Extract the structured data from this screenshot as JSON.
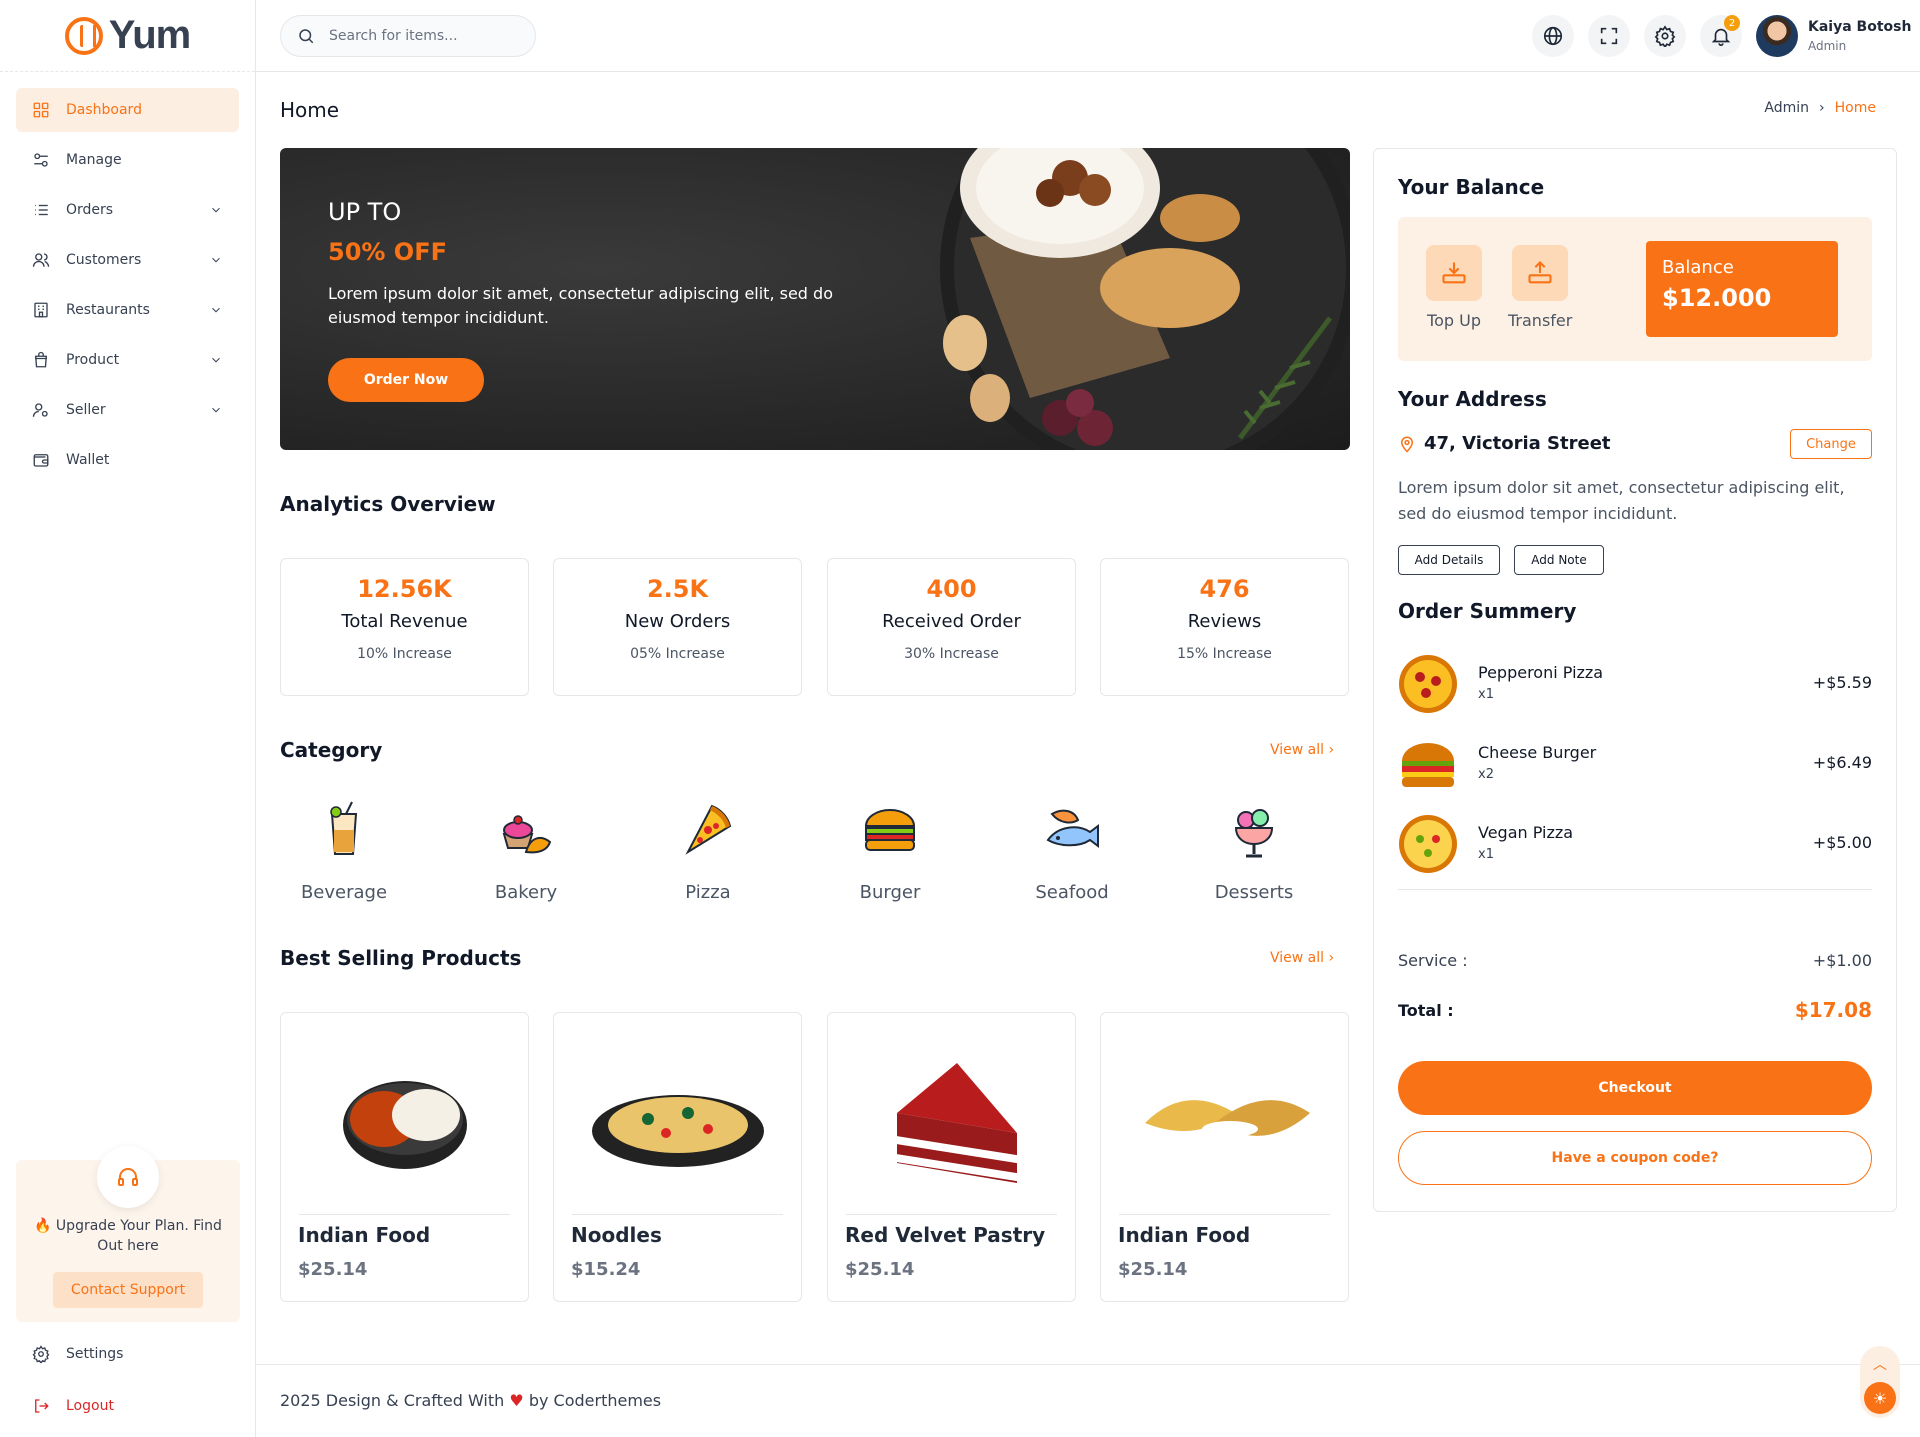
{
  "app": {
    "name": "Yum"
  },
  "sidebar": {
    "items": [
      {
        "label": "Dashboard",
        "icon": "grid-icon",
        "active": true,
        "expandable": false
      },
      {
        "label": "Manage",
        "icon": "sliders-icon",
        "active": false,
        "expandable": false
      },
      {
        "label": "Orders",
        "icon": "list-icon",
        "active": false,
        "expandable": true
      },
      {
        "label": "Customers",
        "icon": "users-icon",
        "active": false,
        "expandable": true
      },
      {
        "label": "Restaurants",
        "icon": "building-icon",
        "active": false,
        "expandable": true
      },
      {
        "label": "Product",
        "icon": "bag-icon",
        "active": false,
        "expandable": true
      },
      {
        "label": "Seller",
        "icon": "user-gear-icon",
        "active": false,
        "expandable": true
      },
      {
        "label": "Wallet",
        "icon": "wallet-icon",
        "active": false,
        "expandable": false
      }
    ],
    "upgrade": {
      "text": "🔥 Upgrade Your Plan. Find Out here",
      "button": "Contact Support"
    },
    "settings": "Settings",
    "logout": "Logout"
  },
  "topbar": {
    "search_placeholder": "Search for items...",
    "notification_count": "2",
    "user": {
      "name": "Kaiya Botosh",
      "role": "Admin"
    }
  },
  "page": {
    "title": "Home",
    "breadcrumb": [
      "Admin",
      "Home"
    ]
  },
  "hero": {
    "line1": "UP TO",
    "line2": "50% OFF",
    "description": "Lorem ipsum dolor sit amet, consectetur adipiscing elit, sed do eiusmod tempor incididunt.",
    "button": "Order Now"
  },
  "analytics": {
    "title": "Analytics Overview",
    "stats": [
      {
        "value": "12.56K",
        "label": "Total Revenue",
        "sub": "10% Increase"
      },
      {
        "value": "2.5K",
        "label": "New Orders",
        "sub": "05% Increase"
      },
      {
        "value": "400",
        "label": "Received Order",
        "sub": "30% Increase"
      },
      {
        "value": "476",
        "label": "Reviews",
        "sub": "15% Increase"
      }
    ]
  },
  "category": {
    "title": "Category",
    "view_all": "View all",
    "items": [
      {
        "label": "Beverage",
        "icon": "beverage-icon"
      },
      {
        "label": "Bakery",
        "icon": "bakery-icon"
      },
      {
        "label": "Pizza",
        "icon": "pizza-icon"
      },
      {
        "label": "Burger",
        "icon": "burger-icon"
      },
      {
        "label": "Seafood",
        "icon": "seafood-icon"
      },
      {
        "label": "Desserts",
        "icon": "desserts-icon"
      }
    ]
  },
  "best_selling": {
    "title": "Best Selling Products",
    "view_all": "View all",
    "items": [
      {
        "name": "Indian Food",
        "price": "$25.14"
      },
      {
        "name": "Noodles",
        "price": "$15.24"
      },
      {
        "name": "Red Velvet Pastry",
        "price": "$25.14"
      },
      {
        "name": "Indian Food",
        "price": "$25.14"
      }
    ]
  },
  "balance": {
    "title": "Your Balance",
    "top_up": "Top Up",
    "transfer": "Transfer",
    "label": "Balance",
    "amount": "$12.000"
  },
  "address": {
    "title": "Your Address",
    "street": "47, Victoria Street",
    "change": "Change",
    "description": "Lorem ipsum dolor sit amet, consectetur adipiscing elit, sed do eiusmod tempor incididunt.",
    "add_details": "Add Details",
    "add_note": "Add Note"
  },
  "order_summary": {
    "title": "Order Summery",
    "items": [
      {
        "name": "Pepperoni Pizza",
        "qty": "x1",
        "price": "+$5.59"
      },
      {
        "name": "Cheese Burger",
        "qty": "x2",
        "price": "+$6.49"
      },
      {
        "name": "Vegan Pizza",
        "qty": "x1",
        "price": "+$5.00"
      }
    ],
    "service_label": "Service :",
    "service_value": "+$1.00",
    "total_label": "Total :",
    "total_value": "$17.08",
    "checkout": "Checkout",
    "coupon": "Have a coupon code?"
  },
  "footer": {
    "text_before": "2025 Design & Crafted With",
    "text_after": "by Coderthemes"
  },
  "colors": {
    "accent": "#f97316",
    "accent_soft": "#fdeee2"
  }
}
